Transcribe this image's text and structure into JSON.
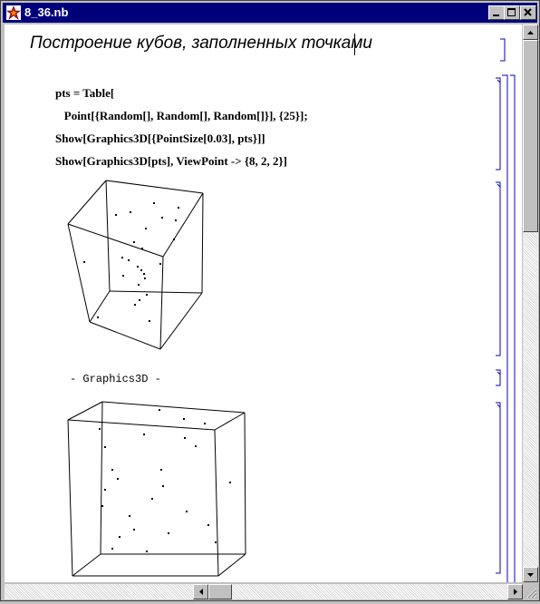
{
  "window": {
    "title": "8_36.nb"
  },
  "notebook": {
    "heading": "Построение кубов, заполненных точками",
    "input": [
      "pts = Table[",
      "   Point[{Random[], Random[], Random[]}], {25}];",
      "Show[Graphics3D[{PointSize[0.03], pts}]]",
      "Show[Graphics3D[pts], ViewPoint -> {8, 2, 2}]"
    ],
    "output_label": "- Graphics3D -"
  }
}
